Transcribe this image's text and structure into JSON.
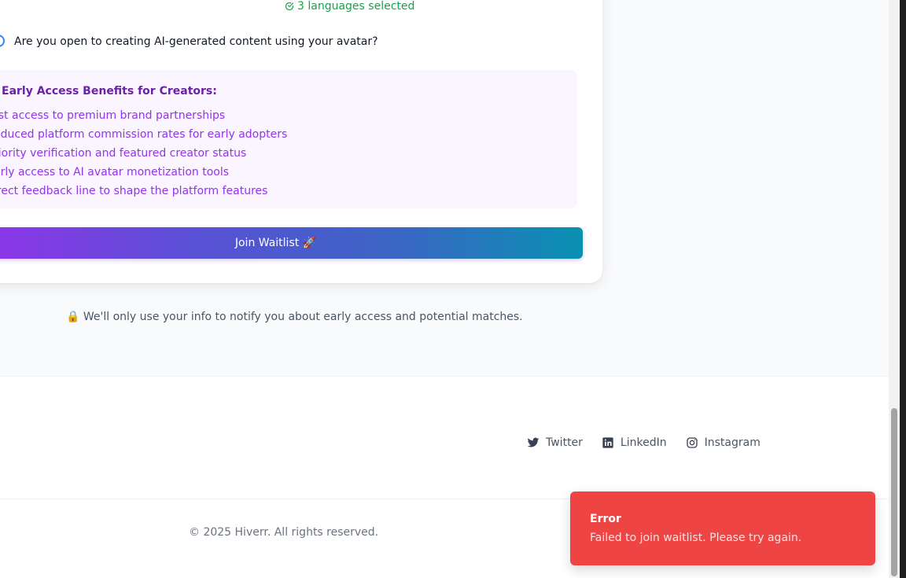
{
  "form": {
    "languages_selected": "3 languages selected",
    "question": "Are you open to creating AI-generated content using your avatar?",
    "benefits_title": "Early Access Benefits for Creators:",
    "benefits": [
      "rst access to premium brand partnerships",
      "educed platform commission rates for early adopters",
      "riority verification and featured creator status",
      "arly access to AI avatar monetization tools",
      "irect feedback line to shape the platform features"
    ],
    "join_button": "Join Waitlist 🚀",
    "privacy_note": "🔒 We'll only use your info to notify you about early access and potential matches."
  },
  "footer": {
    "socials": [
      {
        "label": "Twitter",
        "icon": "twitter-icon"
      },
      {
        "label": "LinkedIn",
        "icon": "linkedin-icon"
      },
      {
        "label": "Instagram",
        "icon": "instagram-icon"
      }
    ],
    "copyright": "© 2025 Hiverr. All rights reserved."
  },
  "toast": {
    "title": "Error",
    "message": "Failed to join waitlist. Please try again."
  },
  "colors": {
    "success": "#16a34a",
    "accent_purple": "#9333ea",
    "accent_teal": "#0891b2",
    "error": "#ef4444"
  }
}
